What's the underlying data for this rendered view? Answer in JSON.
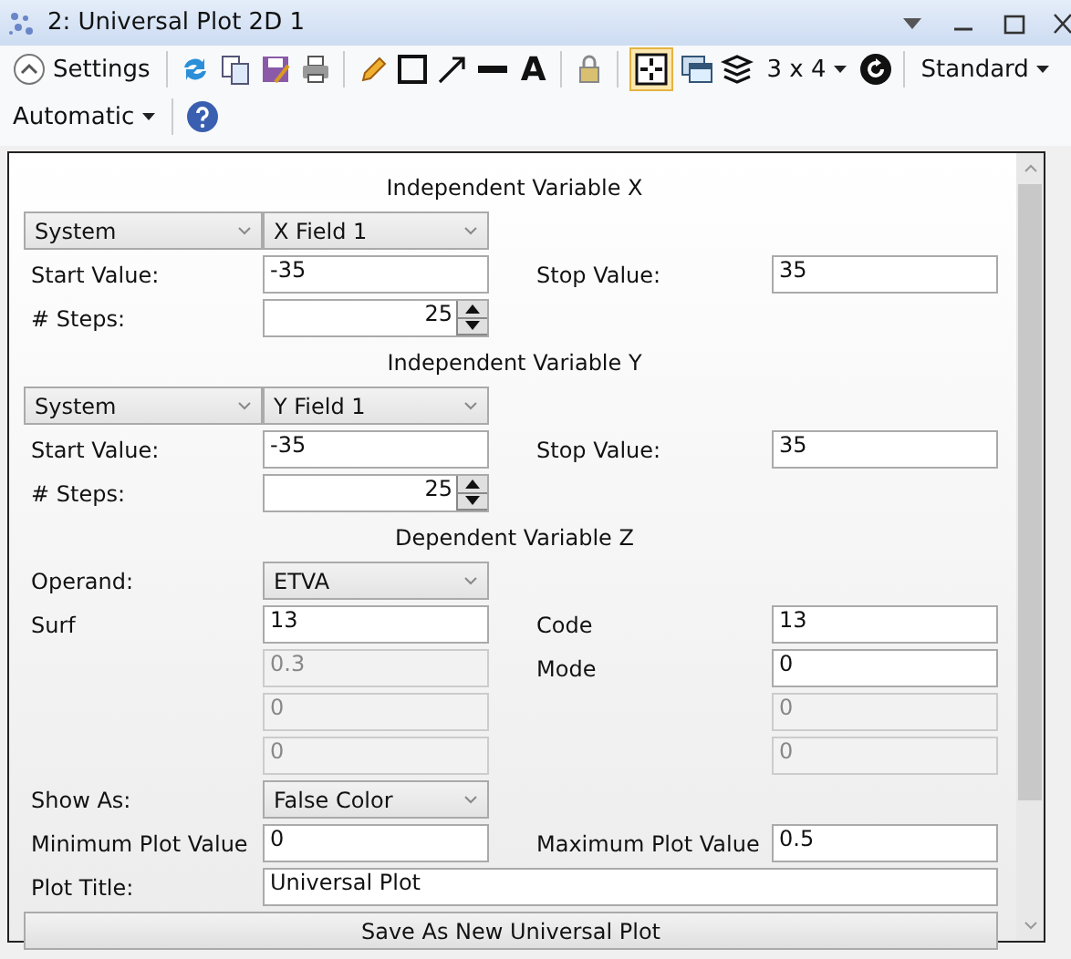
{
  "window": {
    "title": "2: Universal Plot 2D 1"
  },
  "toolbar": {
    "settings": {
      "label": "Settings",
      "expanded": true
    },
    "text_tool": "A",
    "grid_toggle_selected": true,
    "layout": "3 x 4",
    "style": "Standard",
    "scale": "Automatic"
  },
  "x": {
    "heading": "Independent Variable X",
    "source": "System",
    "field": "X Field 1",
    "start_label": "Start Value:",
    "start": "-35",
    "stop_label": "Stop Value:",
    "stop": "35",
    "steps_label": "# Steps:",
    "steps": "25"
  },
  "y": {
    "heading": "Independent Variable Y",
    "source": "System",
    "field": "Y Field 1",
    "start_label": "Start Value:",
    "start": "-35",
    "stop_label": "Stop Value:",
    "stop": "35",
    "steps_label": "# Steps:",
    "steps": "25"
  },
  "z": {
    "heading": "Dependent Variable Z",
    "operand_label": "Operand:",
    "operand": "ETVA",
    "params": [
      {
        "label": "Surf",
        "value": "13",
        "disabled": false
      },
      {
        "label": "Code",
        "value": "13",
        "disabled": false
      },
      {
        "value": "0.3",
        "disabled": true
      },
      {
        "label": "Mode",
        "value": "0",
        "disabled": false
      },
      {
        "value": "0",
        "disabled": true
      },
      {
        "value": "0",
        "disabled": true
      },
      {
        "value": "0",
        "disabled": true
      },
      {
        "value": "0",
        "disabled": true
      }
    ]
  },
  "show_as_label": "Show As:",
  "show_as": "False Color",
  "min_label": "Minimum Plot Value",
  "min": "0",
  "max_label": "Maximum Plot Value",
  "max": "0.5",
  "title_label": "Plot Title:",
  "title": "Universal Plot",
  "save_button": "Save As New Universal Plot"
}
